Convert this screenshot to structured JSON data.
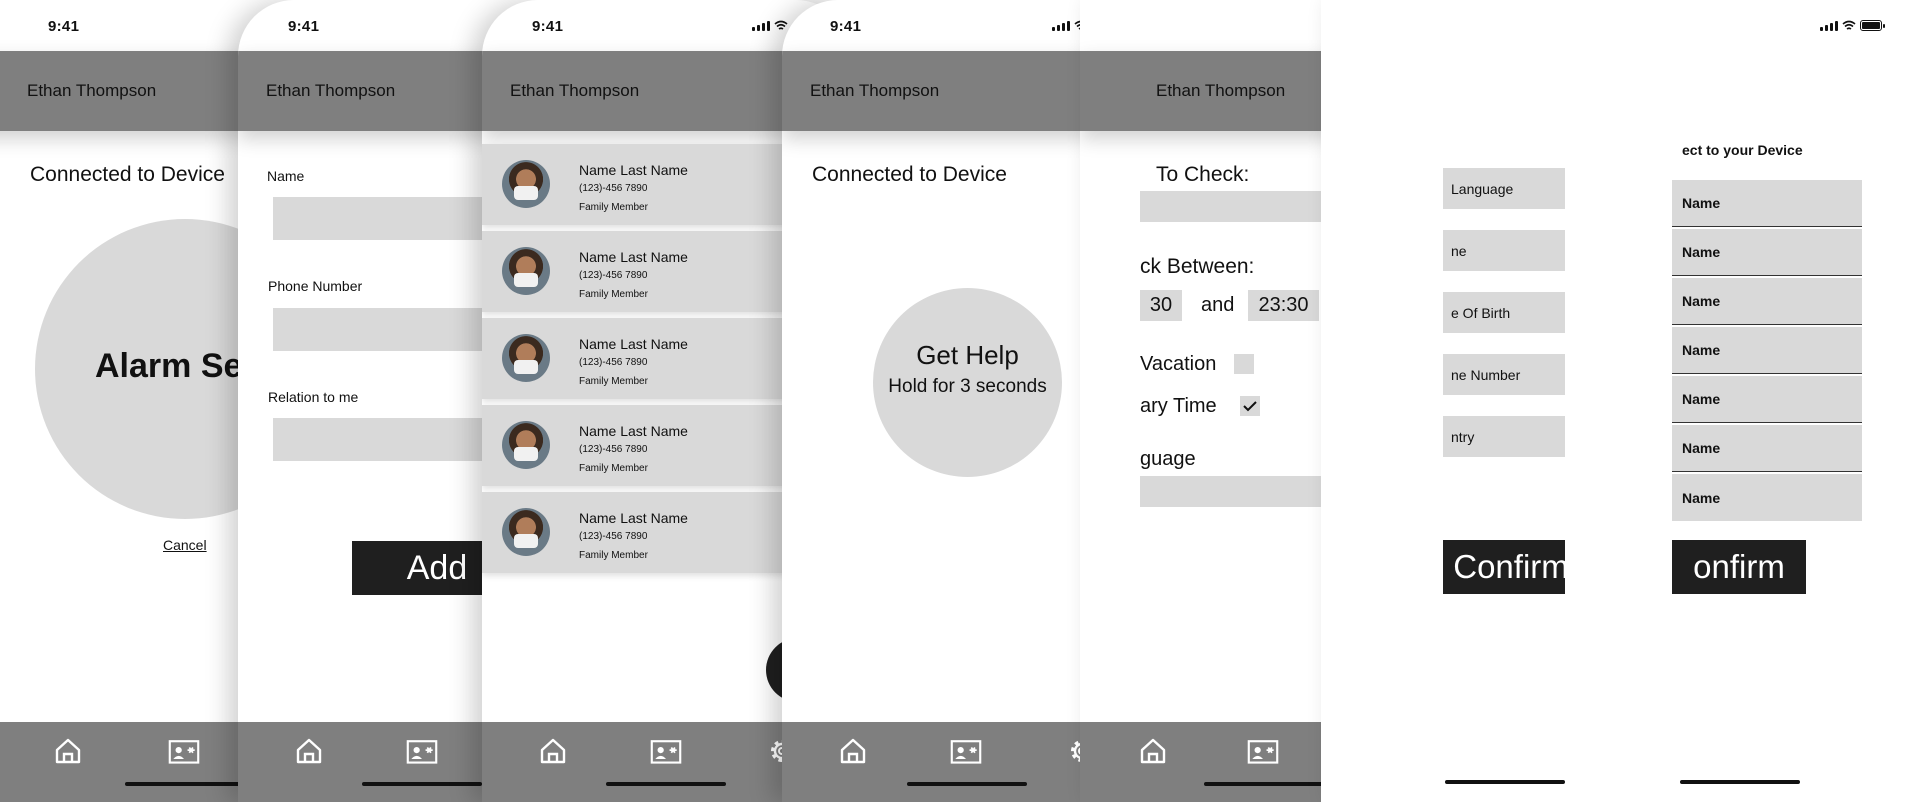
{
  "user_name": "Ethan Thompson",
  "status_time": "9:41",
  "screen1": {
    "subtitle": "Connected to Device",
    "alarm_text": "Alarm Se",
    "cancel_label": "Cancel"
  },
  "screen2": {
    "name_label": "Name",
    "phone_label": "Phone Number",
    "relation_label": "Relation to me",
    "add_label": "Add"
  },
  "screen3": {
    "contacts": [
      {
        "name": "Name Last Name",
        "phone": "(123)-456 7890",
        "relation": "Family Member"
      },
      {
        "name": "Name Last Name",
        "phone": "(123)-456 7890",
        "relation": "Family Member"
      },
      {
        "name": "Name Last Name",
        "phone": "(123)-456 7890",
        "relation": "Family Member"
      },
      {
        "name": "Name Last Name",
        "phone": "(123)-456 7890",
        "relation": "Family Member"
      },
      {
        "name": "Name Last Name",
        "phone": "(123)-456 7890",
        "relation": "Family Member"
      }
    ]
  },
  "screen4": {
    "subtitle": "Connected to Device",
    "help_title": "Get Help",
    "help_sub": "Hold for 3 seconds"
  },
  "screen5": {
    "time_label": "To Check:",
    "between_label": "ck Between:",
    "time_from": "30",
    "and_label": "and",
    "time_to": "23:30",
    "vacation_label": "Vacation",
    "vacation_checked": false,
    "custom_label": "ary Time",
    "custom_checked": true,
    "language_label": "guage"
  },
  "screen6": {
    "fields": [
      "Language",
      "ne",
      "e Of Birth",
      "ne Number"
    ],
    "country_label": "ntry",
    "confirm_label": "Confirm"
  },
  "screen7": {
    "title": "ect to your Device",
    "devices": [
      "Name",
      "Name",
      "Name",
      "Name",
      "Name",
      "Name",
      "Name"
    ],
    "confirm_label": "onfirm"
  }
}
